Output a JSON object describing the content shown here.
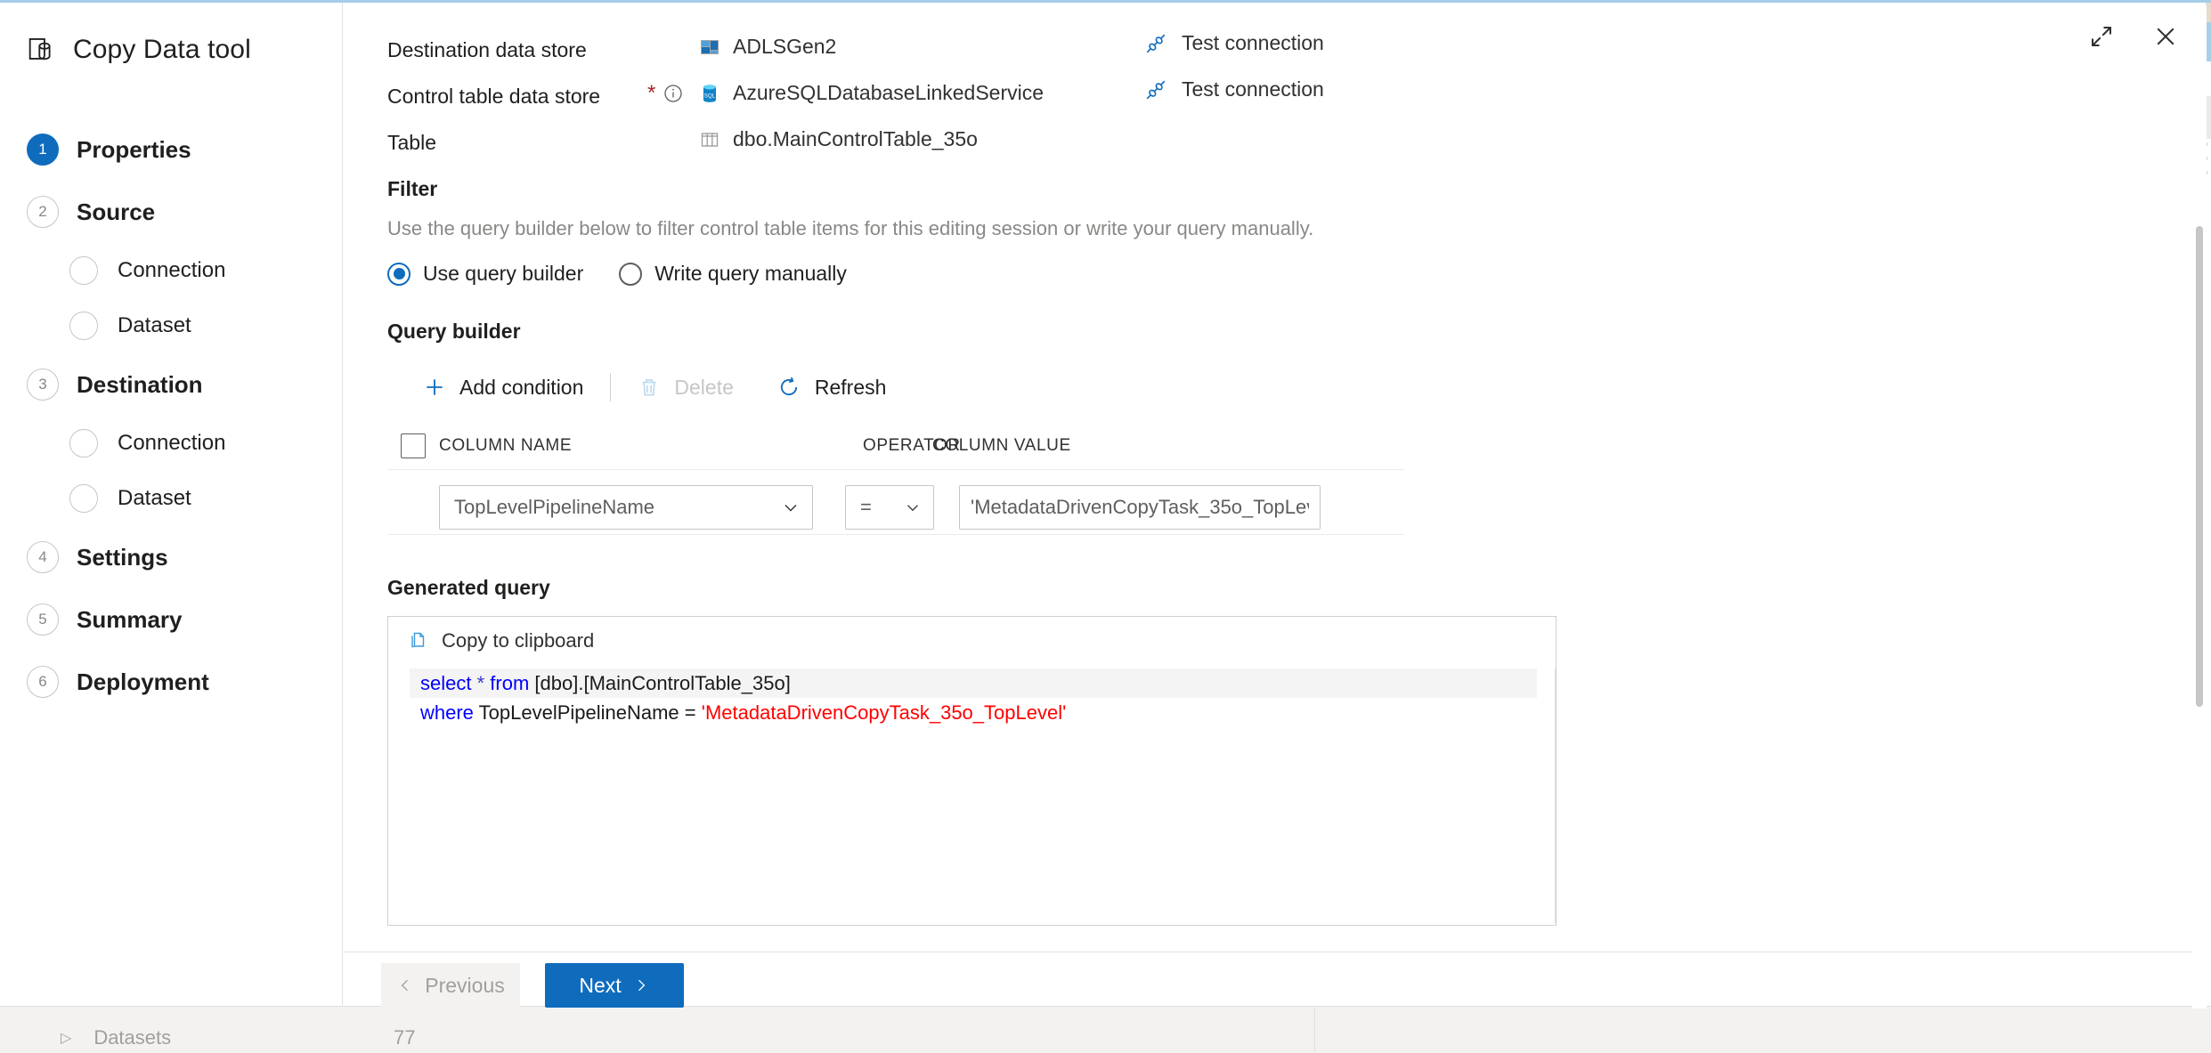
{
  "window": {
    "title": "Copy Data tool",
    "title_icon": "database-icon",
    "expand_icon": "expand-diagonal-icon",
    "close_icon": "close-icon"
  },
  "sidebar": {
    "steps": [
      {
        "num": "1",
        "label": "Properties",
        "state": "active",
        "substeps": []
      },
      {
        "num": "2",
        "label": "Source",
        "state": "idle",
        "substeps": [
          {
            "label": "Connection"
          },
          {
            "label": "Dataset"
          }
        ]
      },
      {
        "num": "3",
        "label": "Destination",
        "state": "idle",
        "substeps": [
          {
            "label": "Connection"
          },
          {
            "label": "Dataset"
          }
        ]
      },
      {
        "num": "4",
        "label": "Settings",
        "state": "idle",
        "substeps": []
      },
      {
        "num": "5",
        "label": "Summary",
        "state": "idle",
        "substeps": []
      },
      {
        "num": "6",
        "label": "Deployment",
        "state": "idle",
        "substeps": []
      }
    ]
  },
  "form": {
    "destination_data_store": {
      "label": "Destination data store",
      "value": "ADLSGen2",
      "value_icon": "adls-gen2-icon",
      "test_connection_label": "Test connection",
      "test_connection_icon": "plug-connection-icon"
    },
    "control_table_data_store": {
      "label": "Control table data store",
      "required_marker": "*",
      "info_icon": "info-circle-icon",
      "value": "AzureSQLDatabaseLinkedService",
      "value_icon": "sql-database-icon",
      "test_connection_label": "Test connection",
      "test_connection_icon": "plug-connection-icon"
    },
    "table": {
      "label": "Table",
      "value": "dbo.MainControlTable_35o",
      "value_icon": "table-icon"
    }
  },
  "filter": {
    "title": "Filter",
    "description": "Use the query builder below to filter control table items for this editing session or write your query manually.",
    "options": [
      {
        "label": "Use query builder",
        "selected": true
      },
      {
        "label": "Write query manually",
        "selected": false
      }
    ]
  },
  "query_builder": {
    "title": "Query builder",
    "toolbar": [
      {
        "label": "Add condition",
        "icon": "plus-icon",
        "disabled": false
      },
      {
        "label": "Delete",
        "icon": "trash-icon",
        "disabled": true
      },
      {
        "label": "Refresh",
        "icon": "refresh-icon",
        "disabled": false
      }
    ],
    "columns": [
      "COLUMN NAME",
      "OPERATOR",
      "COLUMN VALUE"
    ],
    "rows": [
      {
        "column_name": "TopLevelPipelineName",
        "operator": "=",
        "column_value": "'MetadataDrivenCopyTask_35o_TopLeve"
      }
    ]
  },
  "generated_query": {
    "title": "Generated query",
    "copy_label": "Copy to clipboard",
    "copy_icon": "copy-icon",
    "lines": [
      {
        "highlighted": true,
        "tokens": [
          {
            "text": "select",
            "kind": "keyword"
          },
          {
            "text": " ",
            "kind": "plain"
          },
          {
            "text": "*",
            "kind": "operator"
          },
          {
            "text": " ",
            "kind": "plain"
          },
          {
            "text": "from",
            "kind": "keyword"
          },
          {
            "text": " [dbo].[MainControlTable_35o]",
            "kind": "plain"
          }
        ]
      },
      {
        "highlighted": false,
        "tokens": [
          {
            "text": "where",
            "kind": "keyword"
          },
          {
            "text": " TopLevelPipelineName = ",
            "kind": "plain"
          },
          {
            "text": "'MetadataDrivenCopyTask_35o_TopLevel'",
            "kind": "string"
          }
        ]
      }
    ]
  },
  "footer": {
    "previous_label": "Previous",
    "previous_disabled": true,
    "next_label": "Next",
    "previous_icon": "chevron-left-icon",
    "next_icon": "chevron-right-icon"
  },
  "background": {
    "row_label": "Datasets",
    "row_count": "77",
    "expand_icon": "triangle-right-icon"
  },
  "colors": {
    "accent": "#0f6cbd",
    "required": "#a4262c",
    "keyword": "#0000ff",
    "string": "#ff0000",
    "text": "#201f1e",
    "muted": "#8a8886"
  }
}
